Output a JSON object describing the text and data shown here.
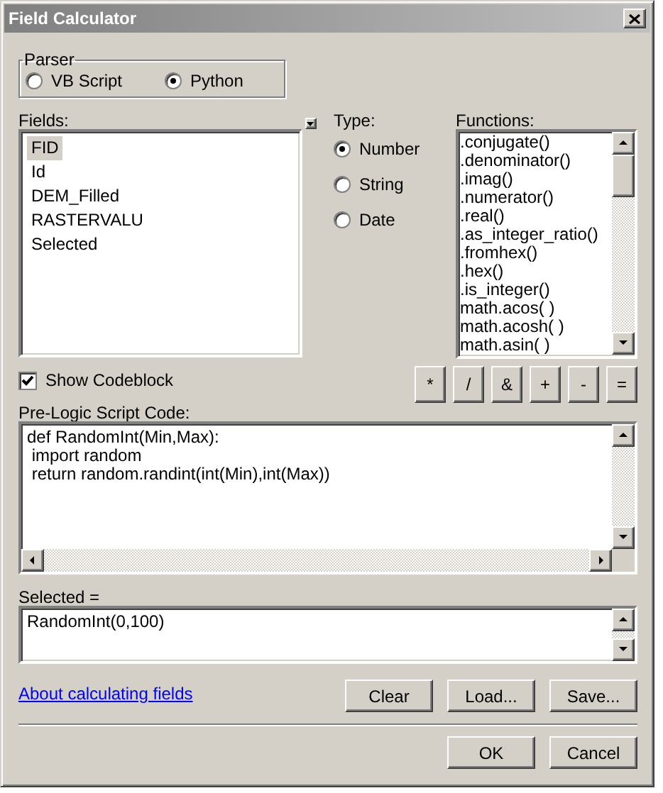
{
  "window": {
    "title": "Field Calculator"
  },
  "parser": {
    "label": "Parser",
    "options": [
      {
        "label": "VB Script",
        "selected": false
      },
      {
        "label": "Python",
        "selected": true
      }
    ]
  },
  "fields": {
    "label": "Fields:",
    "items": [
      {
        "label": "FID",
        "selected": true
      },
      {
        "label": "Id",
        "selected": false
      },
      {
        "label": "DEM_Filled",
        "selected": false
      },
      {
        "label": "RASTERVALU",
        "selected": false
      },
      {
        "label": "Selected",
        "selected": false
      }
    ]
  },
  "type": {
    "label": "Type:",
    "options": [
      {
        "label": "Number",
        "selected": true
      },
      {
        "label": "String",
        "selected": false
      },
      {
        "label": "Date",
        "selected": false
      }
    ]
  },
  "functions": {
    "label": "Functions:",
    "items": [
      ".conjugate()",
      ".denominator()",
      ".imag()",
      ".numerator()",
      ".real()",
      ".as_integer_ratio()",
      ".fromhex()",
      ".hex()",
      ".is_integer()",
      "math.acos( )",
      "math.acosh( )",
      "math.asin( )"
    ]
  },
  "show_codeblock": {
    "label": "Show Codeblock",
    "checked": true
  },
  "operators": [
    "*",
    "/",
    "&",
    "+",
    "-",
    "="
  ],
  "pre_logic": {
    "label": "Pre-Logic Script Code:",
    "value": "def RandomInt(Min,Max):\n import random\n return random.randint(int(Min),int(Max))"
  },
  "expression": {
    "label": "Selected =",
    "value": "RandomInt(0,100)"
  },
  "help_link": "About calculating fields",
  "action_buttons": [
    "Clear",
    "Load...",
    "Save..."
  ],
  "dialog_buttons": [
    "OK",
    "Cancel"
  ]
}
